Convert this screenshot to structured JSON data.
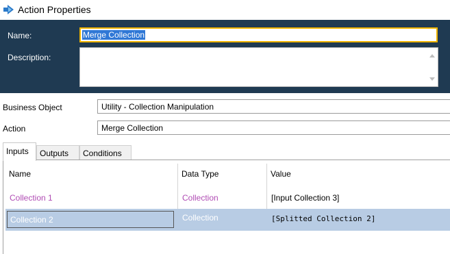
{
  "window": {
    "title": "Action Properties",
    "icon": "action-arrow-icon"
  },
  "header": {
    "name_label": "Name:",
    "name_value": "Merge Collection",
    "description_label": "Description:",
    "description_value": ""
  },
  "form": {
    "business_object_label": "Business Object",
    "business_object_value": "Utility - Collection Manipulation",
    "action_label": "Action",
    "action_value": "Merge Collection"
  },
  "tabs": [
    {
      "label": "Inputs",
      "active": true
    },
    {
      "label": "Outputs",
      "active": false
    },
    {
      "label": "Conditions",
      "active": false
    }
  ],
  "grid": {
    "columns": [
      "Name",
      "Data Type",
      "Value"
    ],
    "rows": [
      {
        "name": "Collection 1",
        "data_type": "Collection",
        "value": "[Input Collection 3]",
        "selected": false
      },
      {
        "name": "Collection 2",
        "data_type": "Collection",
        "value": "[Splitted Collection 2]",
        "selected": true
      }
    ]
  },
  "colors": {
    "header_panel": "#1f3a52",
    "focus_border": "#f0b400",
    "selection": "#3078d6",
    "row_selected": "#b8cce4",
    "name_purple": "#b04cb4"
  }
}
